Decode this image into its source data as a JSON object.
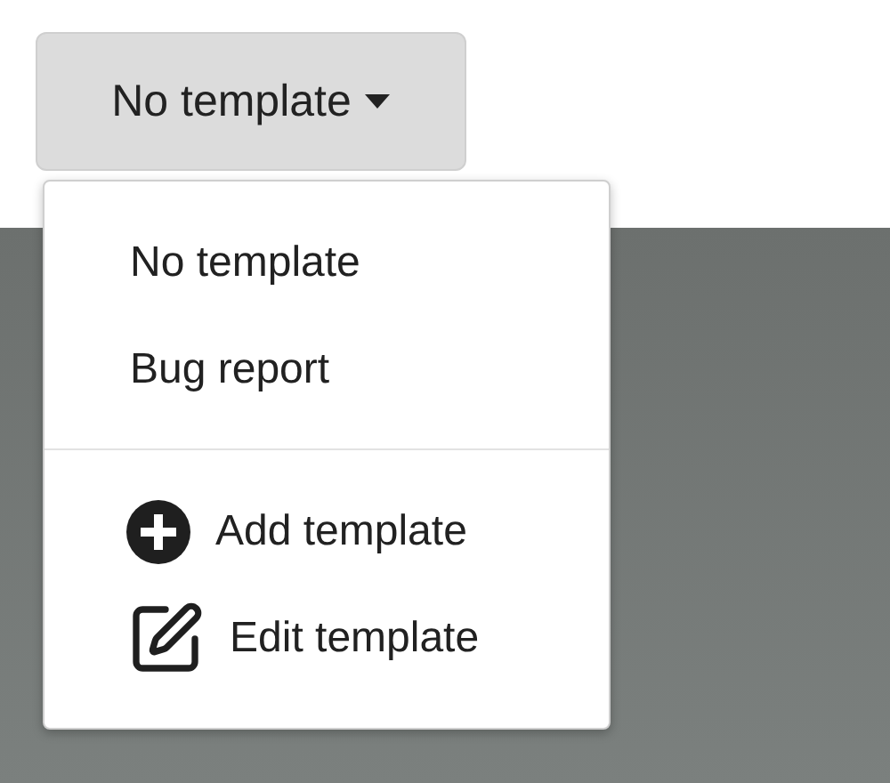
{
  "template_button": {
    "label": "No template",
    "expanded": true
  },
  "menu": {
    "sections": [
      {
        "items": [
          {
            "kind": "option",
            "label": "No template"
          },
          {
            "kind": "option",
            "label": "Bug report"
          }
        ]
      },
      {
        "items": [
          {
            "kind": "add",
            "label": "Add template"
          },
          {
            "kind": "edit",
            "label": "Edit template"
          }
        ]
      }
    ]
  }
}
